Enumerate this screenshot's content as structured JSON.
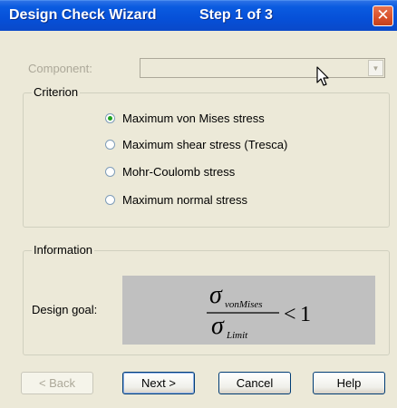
{
  "window": {
    "title": "Design Check Wizard",
    "step": "Step 1 of 3",
    "close_glyph": "✕"
  },
  "component": {
    "label": "Component:",
    "value": "",
    "arrow_glyph": "▼"
  },
  "criterion": {
    "legend": "Criterion",
    "options": [
      {
        "label": "Maximum von Mises stress",
        "checked": true
      },
      {
        "label": "Maximum shear stress (Tresca)",
        "checked": false
      },
      {
        "label": "Mohr-Coulomb stress",
        "checked": false
      },
      {
        "label": "Maximum normal stress",
        "checked": false
      }
    ]
  },
  "information": {
    "legend": "Information",
    "goal_label": "Design goal:",
    "formula": {
      "numerator_symbol": "σ",
      "numerator_subscript": "vonMises",
      "denominator_symbol": "σ",
      "denominator_subscript": "Limit",
      "relation": "<",
      "rhs": "1"
    }
  },
  "buttons": {
    "back": "< Back",
    "next": "Next >",
    "cancel": "Cancel",
    "help": "Help"
  },
  "icons": [
    "close-icon",
    "chevron-down-icon",
    "mouse-pointer-icon"
  ]
}
